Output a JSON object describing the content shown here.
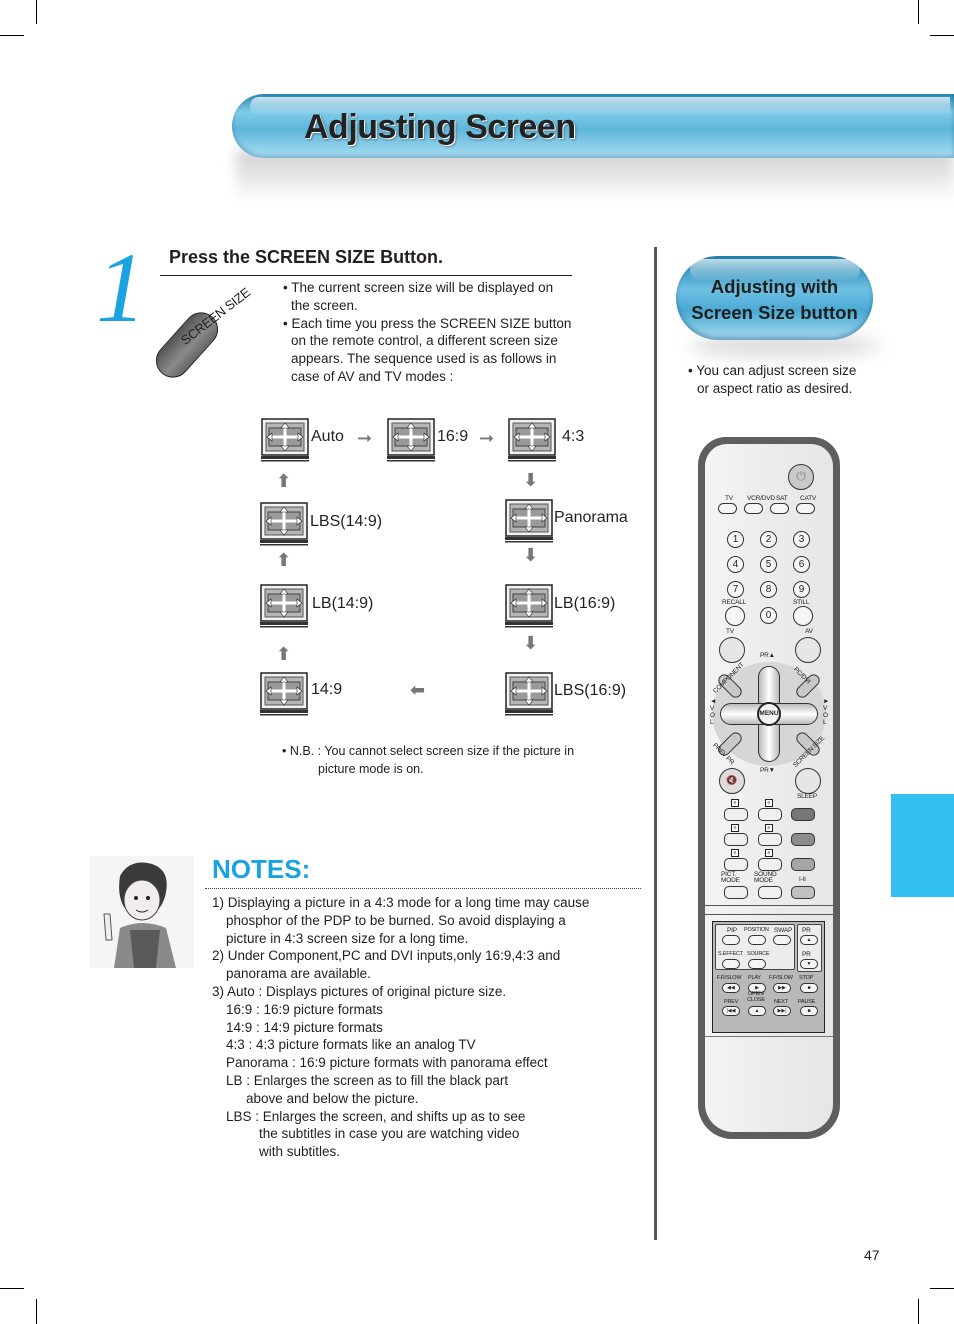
{
  "header": {
    "title": "Adjusting Screen"
  },
  "step": {
    "number": "1",
    "title": "Press the SCREEN SIZE Button.",
    "button_label": "SCREEN SIZE",
    "bullets": [
      "• The current screen size will be displayed on the screen.",
      "• Each time you press the SCREEN SIZE button on the remote control, a different screen size appears. The sequence used is as follows in case of AV and TV modes :"
    ]
  },
  "sequence": {
    "modes": [
      "Auto",
      "16:9",
      "4:3",
      "Panorama",
      "LB(16:9)",
      "LBS(16:9)",
      "14:9",
      "LB(14:9)",
      "LBS(14:9)"
    ],
    "icon": "tv-screen-arrows-icon",
    "arrow_right": "➞",
    "arrow_down": "⬇",
    "arrow_left": "⬅",
    "arrow_up": "⬆"
  },
  "nb": {
    "first": "• N.B. : You cannot select screen size if the picture in",
    "second": "picture mode is on."
  },
  "notes": {
    "title": "NOTES:",
    "lines": [
      {
        "text": "1) Displaying a picture in a 4:3 mode for a long time may cause",
        "indent": 0
      },
      {
        "text": "phosphor of the PDP to be burned. So avoid displaying a",
        "indent": 1
      },
      {
        "text": "picture in 4:3 screen size for a long time.",
        "indent": 1
      },
      {
        "text": "2) Under Component,PC and DVI inputs,only 16:9,4:3 and",
        "indent": 0
      },
      {
        "text": "panorama are available.",
        "indent": 1
      },
      {
        "text": "3) Auto : Displays pictures of original picture size.",
        "indent": 0
      },
      {
        "text": "16:9 : 16:9 picture formats",
        "indent": 1
      },
      {
        "text": "14:9 : 14:9 picture formats",
        "indent": 1
      },
      {
        "text": "4:3 : 4:3 picture formats like an analog TV",
        "indent": 1
      },
      {
        "text": "Panorama : 16:9 picture formats with panorama effect",
        "indent": 1
      },
      {
        "text": "LB : Enlarges the screen as to fill the black part",
        "indent": 1
      },
      {
        "text": "above and below the picture.",
        "indent": 2
      },
      {
        "text": "LBS : Enlarges the screen, and shifts up as to see",
        "indent": 1
      },
      {
        "text": "the subtitles in case you are watching video",
        "indent": 3
      },
      {
        "text": "with subtitles.",
        "indent": 3
      }
    ]
  },
  "side": {
    "pill_line1": "Adjusting with",
    "pill_line2": "Screen Size button",
    "bullet_line1": "• You can adjust screen size",
    "bullet_line2": "or aspect ratio as desired."
  },
  "remote": {
    "source_buttons": [
      "TV",
      "VCR/DVD",
      "SAT",
      "CATV"
    ],
    "digits": [
      "1",
      "2",
      "3",
      "4",
      "5",
      "6",
      "7",
      "8",
      "9",
      "0"
    ],
    "recall": "RECALL",
    "still": "STILL",
    "tv": "TV",
    "av": "AV",
    "pr_up": "PR▲",
    "pr_down": "PR▼",
    "component": "COMPONENT",
    "pc_dvi": "PC/DVI",
    "prev_pr": "PREV PR",
    "screen_size": "SCREEN SIZE",
    "vol_left": "◄ V O L",
    "vol_right": "► V O L",
    "menu": "MENU",
    "sleep": "SLEEP",
    "pict_mode": "PICT. MODE",
    "sound_mode": "SOUND MODE",
    "i_ii": "I-II",
    "panel": {
      "pip": "PIP",
      "position": "POSITION",
      "swap": "SWAP",
      "pr": "PR",
      "s_effect": "S.EFFECT",
      "source": "SOURCE",
      "fr_slow": "F.R/SLOW",
      "play": "PLAY",
      "ff_slow": "F.F/SLOW",
      "stop": "STOP",
      "prev": "PREV",
      "open_close": "OPEN/ CLOSE",
      "next": "NEXT",
      "pause": "PAUSE"
    }
  },
  "page_number": "47",
  "colors": {
    "accent": "#1aa3e0",
    "side_tab": "#33bff0"
  }
}
